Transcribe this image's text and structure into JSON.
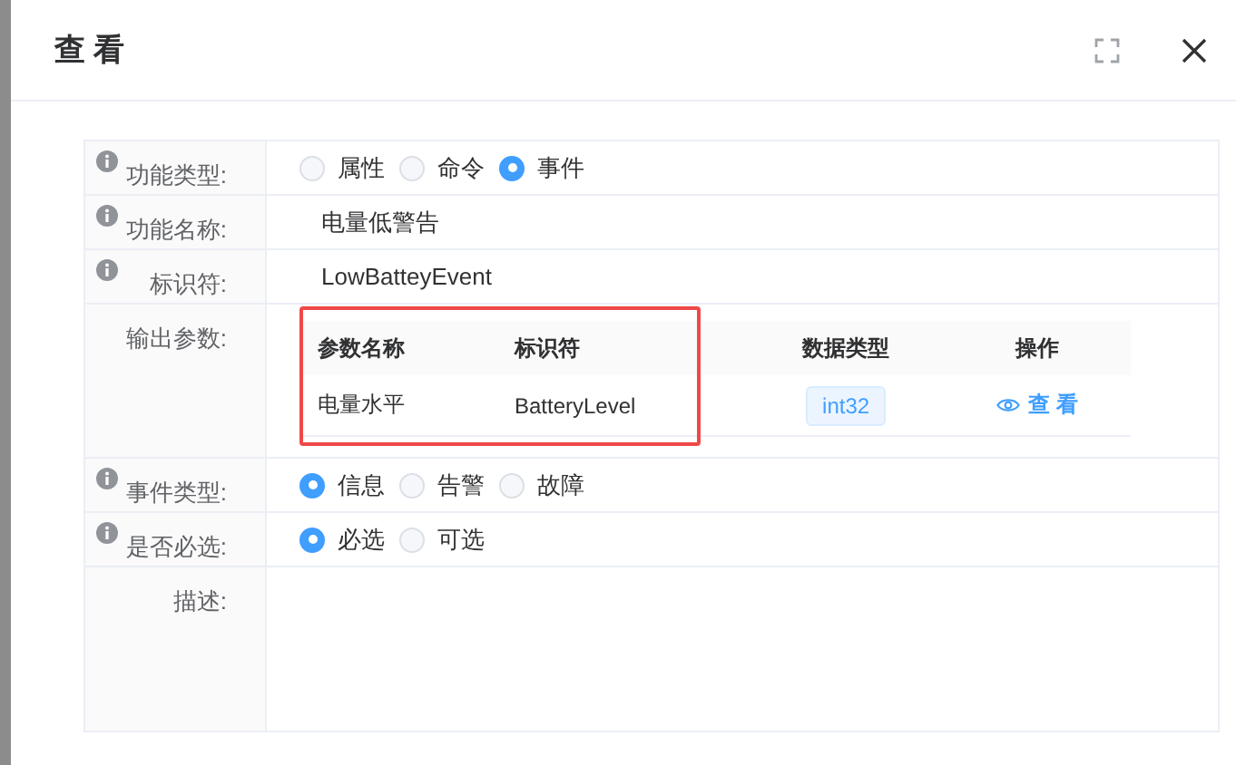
{
  "dialog": {
    "title": "查 看"
  },
  "fields": [
    {
      "kind": "radio",
      "label": "功能类型:",
      "info": true,
      "options": [
        {
          "label": "属性",
          "selected": false
        },
        {
          "label": "命令",
          "selected": false
        },
        {
          "label": "事件",
          "selected": true
        }
      ]
    },
    {
      "kind": "text",
      "label": "功能名称:",
      "info": true,
      "value": "电量低警告"
    },
    {
      "kind": "text",
      "label": "标识符:",
      "info": true,
      "value": "LowBatteyEvent"
    },
    {
      "kind": "table",
      "label": "输出参数:",
      "info": false,
      "highlighted": true,
      "columns": [
        "参数名称",
        "标识符",
        "数据类型",
        "操作"
      ],
      "rows": [
        {
          "name": "电量水平",
          "identifier": "BatteryLevel",
          "data_type": "int32",
          "action": "查 看"
        }
      ]
    },
    {
      "kind": "radio",
      "label": "事件类型:",
      "info": true,
      "options": [
        {
          "label": "信息",
          "selected": true
        },
        {
          "label": "告警",
          "selected": false
        },
        {
          "label": "故障",
          "selected": false
        }
      ]
    },
    {
      "kind": "radio",
      "label": "是否必选:",
      "info": true,
      "options": [
        {
          "label": "必选",
          "selected": true
        },
        {
          "label": "可选",
          "selected": false
        }
      ]
    },
    {
      "kind": "textarea",
      "label": "描述:",
      "info": false
    }
  ]
}
